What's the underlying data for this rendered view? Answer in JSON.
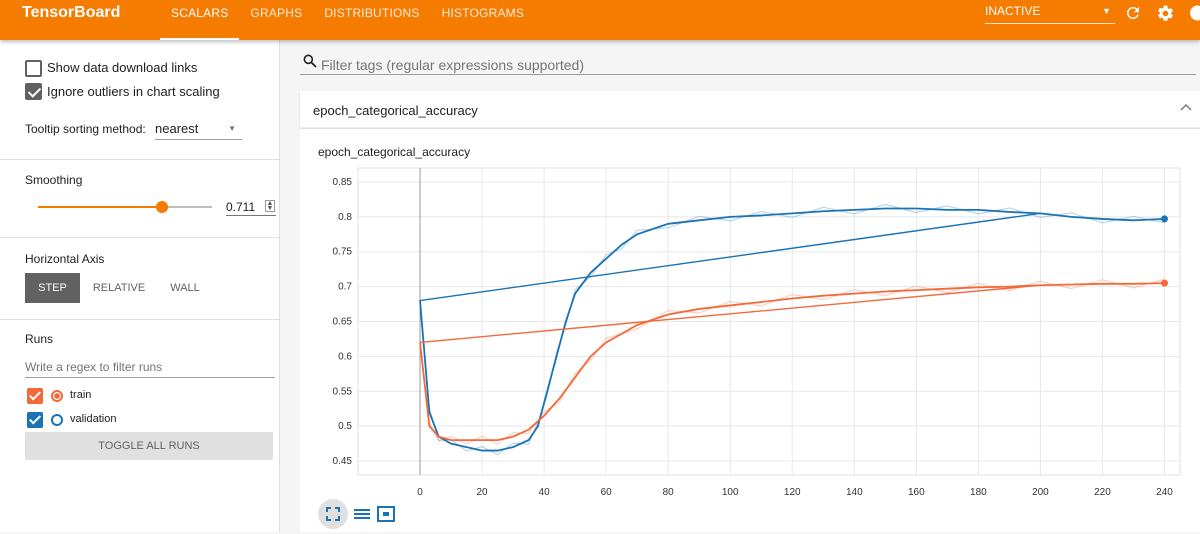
{
  "header": {
    "brand": "TensorBoard",
    "tabs": [
      {
        "label": "SCALARS",
        "active": true
      },
      {
        "label": "GRAPHS",
        "active": false
      },
      {
        "label": "DISTRIBUTIONS",
        "active": false
      },
      {
        "label": "HISTOGRAMS",
        "active": false
      }
    ],
    "status_select": "INACTIVE",
    "icons": [
      "refresh-icon",
      "settings-icon",
      "help-icon"
    ]
  },
  "sidebar": {
    "show_download_links": {
      "label": "Show data download links",
      "checked": false
    },
    "ignore_outliers": {
      "label": "Ignore outliers in chart scaling",
      "checked": true
    },
    "tooltip_sorting": {
      "label": "Tooltip sorting method:",
      "value": "nearest"
    },
    "smoothing": {
      "label": "Smoothing",
      "value": "0.711",
      "fraction": 0.711
    },
    "horizontal_axis": {
      "label": "Horizontal Axis",
      "options": [
        "STEP",
        "RELATIVE",
        "WALL"
      ],
      "selected": "STEP"
    },
    "runs": {
      "label": "Runs",
      "filter_placeholder": "Write a regex to filter runs",
      "items": [
        {
          "name": "train",
          "color": "#f4683a",
          "checked": true,
          "selected": true
        },
        {
          "name": "validation",
          "color": "#1a73b5",
          "checked": true,
          "selected": false
        }
      ],
      "toggle_label": "TOGGLE ALL RUNS"
    }
  },
  "main": {
    "filter_placeholder": "Filter tags (regular expressions supported)",
    "card_title": "epoch_categorical_accuracy",
    "chart_title": "epoch_categorical_accuracy"
  },
  "chart_data": {
    "type": "line",
    "title": "epoch_categorical_accuracy",
    "xlabel": "",
    "ylabel": "",
    "xlim": [
      -20,
      245
    ],
    "ylim": [
      0.43,
      0.87
    ],
    "xticks": [
      0,
      20,
      40,
      60,
      80,
      100,
      120,
      140,
      160,
      180,
      200,
      220,
      240
    ],
    "yticks": [
      0.45,
      0.5,
      0.55,
      0.6,
      0.65,
      0.7,
      0.75,
      0.8,
      0.85
    ],
    "grid": true,
    "series": [
      {
        "name": "validation",
        "color": "#1a73b5",
        "x": [
          0,
          3,
          6,
          10,
          15,
          20,
          25,
          30,
          35,
          38,
          41,
          44,
          47,
          50,
          55,
          60,
          65,
          70,
          80,
          90,
          100,
          110,
          120,
          130,
          140,
          150,
          160,
          170,
          180,
          190,
          200,
          210,
          220,
          230,
          240
        ],
        "y": [
          0.68,
          0.52,
          0.485,
          0.475,
          0.47,
          0.465,
          0.465,
          0.47,
          0.48,
          0.5,
          0.55,
          0.6,
          0.65,
          0.69,
          0.72,
          0.74,
          0.76,
          0.775,
          0.79,
          0.795,
          0.8,
          0.802,
          0.805,
          0.808,
          0.81,
          0.812,
          0.812,
          0.81,
          0.81,
          0.807,
          0.805,
          0.8,
          0.797,
          0.795,
          0.797
        ]
      },
      {
        "name": "train",
        "color": "#f4683a",
        "x": [
          0,
          3,
          6,
          10,
          15,
          20,
          25,
          30,
          35,
          40,
          45,
          50,
          55,
          60,
          70,
          80,
          90,
          100,
          110,
          120,
          130,
          140,
          150,
          160,
          170,
          180,
          190,
          200,
          210,
          220,
          230,
          240
        ],
        "y": [
          0.62,
          0.5,
          0.485,
          0.48,
          0.48,
          0.48,
          0.48,
          0.485,
          0.495,
          0.515,
          0.54,
          0.57,
          0.6,
          0.62,
          0.645,
          0.66,
          0.668,
          0.673,
          0.678,
          0.683,
          0.687,
          0.69,
          0.693,
          0.695,
          0.697,
          0.699,
          0.7,
          0.702,
          0.703,
          0.704,
          0.704,
          0.705
        ]
      }
    ]
  }
}
